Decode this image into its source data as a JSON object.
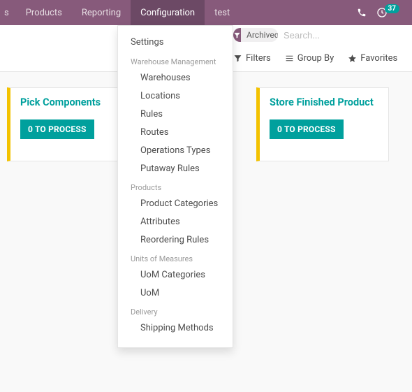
{
  "nav": {
    "items": [
      {
        "label": "s"
      },
      {
        "label": "Products"
      },
      {
        "label": "Reporting"
      },
      {
        "label": "Configuration",
        "active": true
      },
      {
        "label": "test"
      }
    ],
    "badge": "37"
  },
  "dropdown": {
    "settings": "Settings",
    "groups": [
      {
        "header": "Warehouse Management",
        "items": [
          "Warehouses",
          "Locations",
          "Rules",
          "Routes",
          "Operations Types",
          "Putaway Rules"
        ]
      },
      {
        "header": "Products",
        "items": [
          "Product Categories",
          "Attributes",
          "Reordering Rules"
        ]
      },
      {
        "header": "Units of Measures",
        "items": [
          "UoM Categories",
          "UoM"
        ]
      },
      {
        "header": "Delivery",
        "items": [
          "Shipping Methods"
        ]
      }
    ]
  },
  "search": {
    "facet_label": "Archived",
    "placeholder": "Search..."
  },
  "controls": {
    "filters": "Filters",
    "group_by": "Group By",
    "favorites": "Favorites"
  },
  "cards": [
    {
      "title": "Pick Components",
      "button": "0 TO PROCESS"
    },
    {
      "title": "Store Finished Product",
      "button": "0 TO PROCESS"
    }
  ]
}
